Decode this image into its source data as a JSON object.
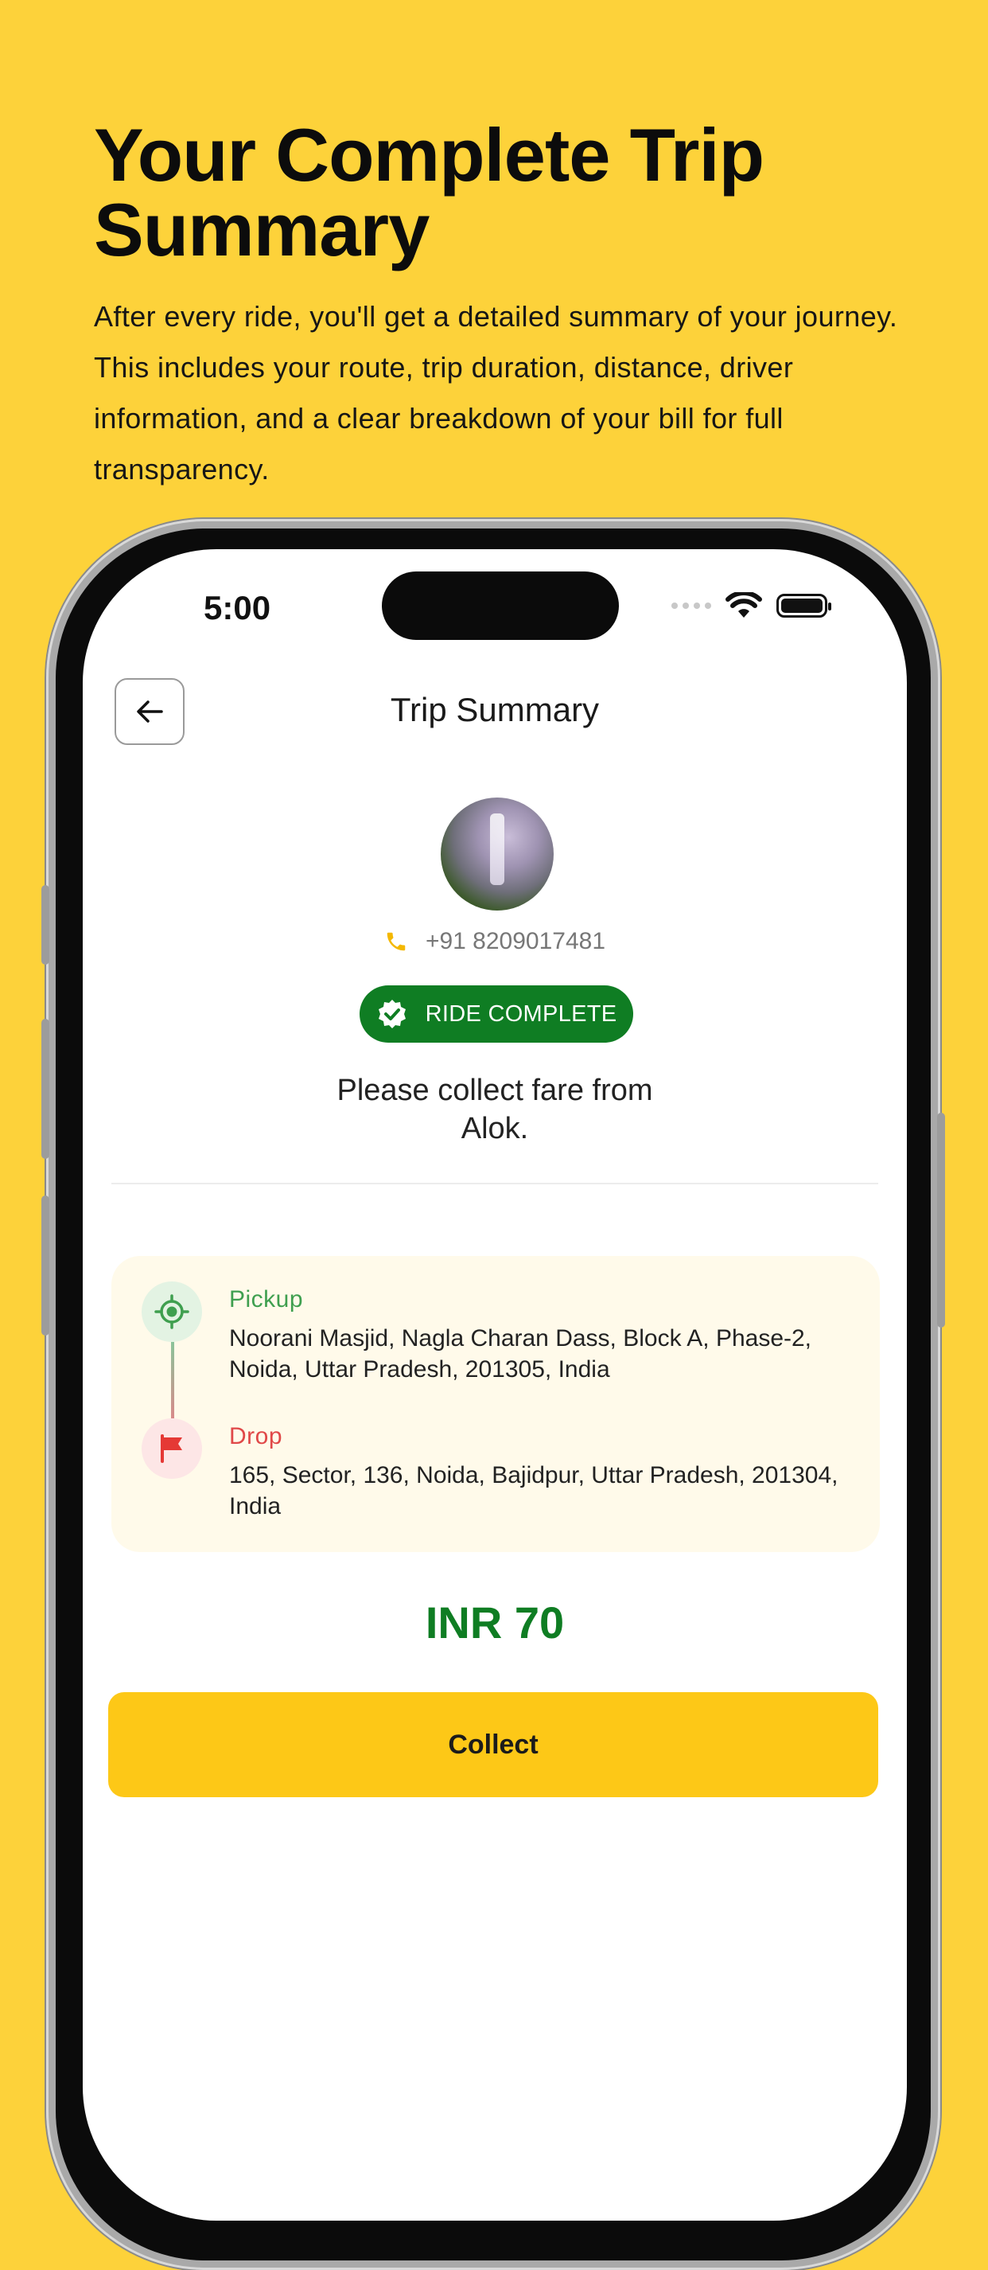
{
  "promo": {
    "title": "Your Complete Trip Summary",
    "description": "After every ride, you'll get a detailed summary of your journey. This includes your route, trip duration, distance, driver information, and a clear breakdown of your bill for full transparency."
  },
  "status_bar": {
    "time": "5:00"
  },
  "header": {
    "title": "Trip Summary"
  },
  "driver": {
    "phone": "+91 8209017481"
  },
  "badge": {
    "label": "RIDE COMPLETE"
  },
  "message": {
    "line1": "Please collect fare from",
    "line2": "Alok."
  },
  "route": {
    "pickup_label": "Pickup",
    "pickup_address": "Noorani Masjid, Nagla Charan Dass, Block A, Phase-2, Noida, Uttar Pradesh, 201305, India",
    "drop_label": "Drop",
    "drop_address": "165, Sector, 136, Noida, Bajidpur, Uttar Pradesh, 201304, India"
  },
  "fare": {
    "amount": "INR 70"
  },
  "actions": {
    "collect_label": "Collect"
  },
  "colors": {
    "background": "#FDD23A",
    "success": "#0F7D23",
    "primary_button": "#FDC817",
    "pickup": "#3F9F4F",
    "drop": "#E04848"
  },
  "icons": [
    "back-arrow-icon",
    "phone-icon",
    "verified-check-icon",
    "location-target-icon",
    "flag-icon",
    "wifi-icon",
    "battery-icon",
    "signal-icon"
  ]
}
